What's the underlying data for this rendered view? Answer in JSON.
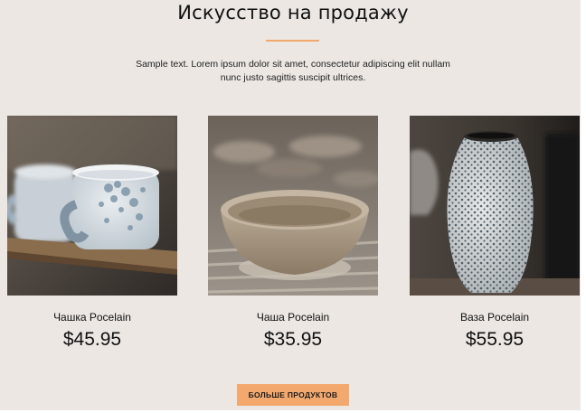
{
  "section": {
    "title": "Искусство на продажу",
    "intro": "Sample text. Lorem ipsum dolor sit amet, consectetur adipiscing elit nullam nunc justo sagittis suscipit ultrices."
  },
  "products": [
    {
      "name": "Чашка Pocelain",
      "price": "$45.95"
    },
    {
      "name": "Чаша Pocelain",
      "price": "$35.95"
    },
    {
      "name": "Ваза Pocelain",
      "price": "$55.95"
    }
  ],
  "more_button": {
    "label": "БОЛЬШЕ ПРОДУКТОВ"
  },
  "colors": {
    "background": "#ece7e3",
    "accent": "#f3a96e",
    "text": "#111111"
  }
}
